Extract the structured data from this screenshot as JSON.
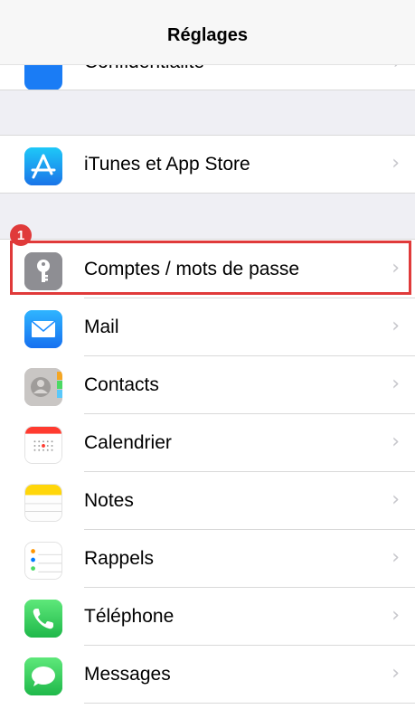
{
  "navbar": {
    "title": "Réglages"
  },
  "partial_row": {
    "label": "Confidentialité",
    "icon": "hand-icon"
  },
  "annotation": {
    "badge": "1",
    "color": "#e03a3a"
  },
  "rows": [
    {
      "label": "iTunes et App Store",
      "icon": "app-store-icon",
      "color": "#1d9bf0"
    },
    {
      "label": "Comptes / mots de passe",
      "icon": "key-icon",
      "color": "#8e8e93"
    },
    {
      "label": "Mail",
      "icon": "envelope-icon",
      "color": "#1a8cff"
    },
    {
      "label": "Contacts",
      "icon": "contacts-icon",
      "color": "#b8b8b8"
    },
    {
      "label": "Calendrier",
      "icon": "calendar-icon",
      "color": "#ffffff"
    },
    {
      "label": "Notes",
      "icon": "notes-icon",
      "color": "#ffd60a"
    },
    {
      "label": "Rappels",
      "icon": "reminders-icon",
      "color": "#ffffff"
    },
    {
      "label": "Téléphone",
      "icon": "phone-icon",
      "color": "#34c759"
    },
    {
      "label": "Messages",
      "icon": "messages-icon",
      "color": "#34c759"
    }
  ],
  "chevron": "›"
}
